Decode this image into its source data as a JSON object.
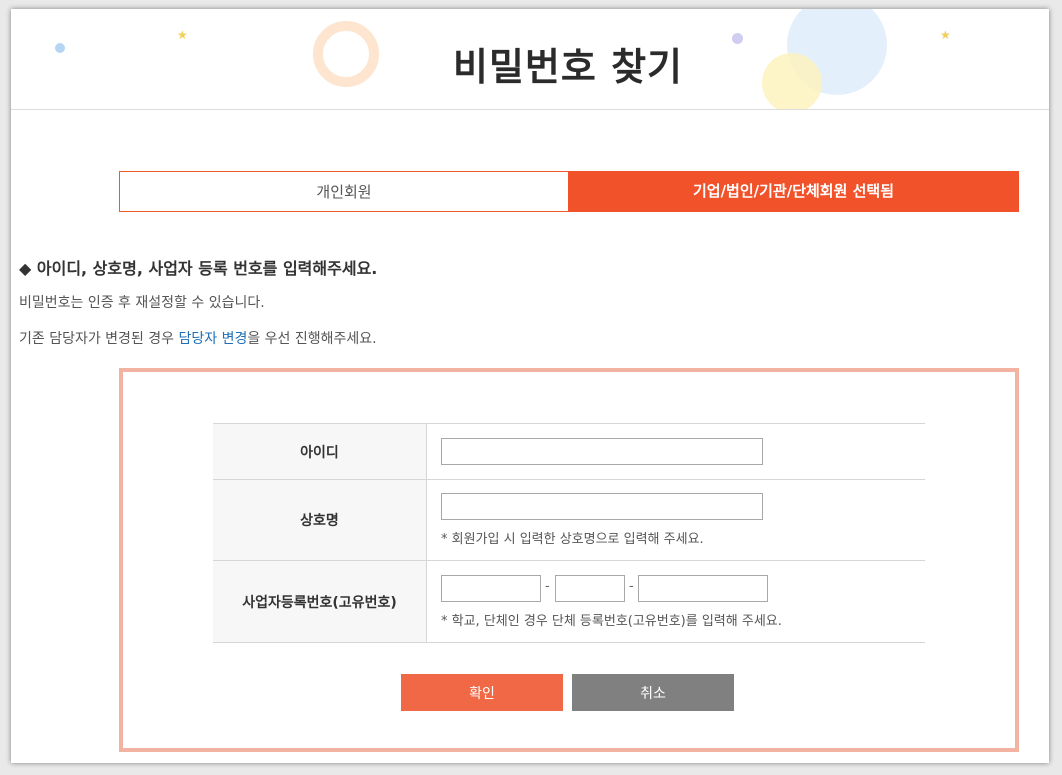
{
  "header": {
    "title": "비밀번호 찾기"
  },
  "tabs": [
    {
      "label": "개인회원"
    },
    {
      "label": "기업/법인/기관/단체회원 선택됨"
    }
  ],
  "intro": {
    "heading": "◆ 아이디, 상호명, 사업자 등록 번호를 입력해주세요.",
    "line1": "비밀번호는 인증 후 재설정할 수 있습니다.",
    "line2_prefix": "기존 담당자가 변경된 경우 ",
    "line2_link": "담당자 변경",
    "line2_suffix": "을 우선 진행해주세요."
  },
  "form": {
    "id_label": "아이디",
    "id_value": "",
    "company_label": "상호명",
    "company_value": "",
    "company_hint": "* 회원가입 시 입력한 상호명으로 입력해 주세요.",
    "bizno_label": "사업자등록번호(고유번호)",
    "bizno_part1": "",
    "bizno_part2": "",
    "bizno_part3": "",
    "bizno_separator": "-",
    "bizno_hint": "* 학교, 단체인 경우 단체 등록번호(고유번호)를 입력해 주세요."
  },
  "buttons": {
    "confirm": "확인",
    "cancel": "취소"
  },
  "colors": {
    "accent": "#f2522a",
    "box_border": "#f2b3a3",
    "confirm_button": "#f06845",
    "cancel_button": "#808080",
    "link": "#1e6fb5"
  }
}
